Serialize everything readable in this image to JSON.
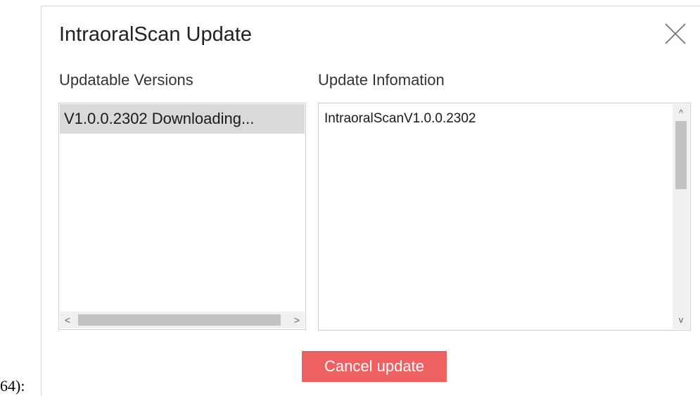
{
  "stray_text": "64):",
  "dialog": {
    "title": "IntraoralScan Update",
    "close_icon": "close-icon",
    "versions_label": "Updatable Versions",
    "info_label": "Update Infomation",
    "versions": [
      {
        "text": "V1.0.0.2302  Downloading..."
      }
    ],
    "info_text": "IntraoralScanV1.0.0.2302",
    "scroll_left_glyph": "<",
    "scroll_right_glyph": ">",
    "scroll_up_glyph": "^",
    "scroll_down_glyph": "v",
    "cancel_label": "Cancel update",
    "colors": {
      "cancel_button_bg": "#ef6060",
      "selected_row_bg": "#d9d9d9"
    }
  }
}
